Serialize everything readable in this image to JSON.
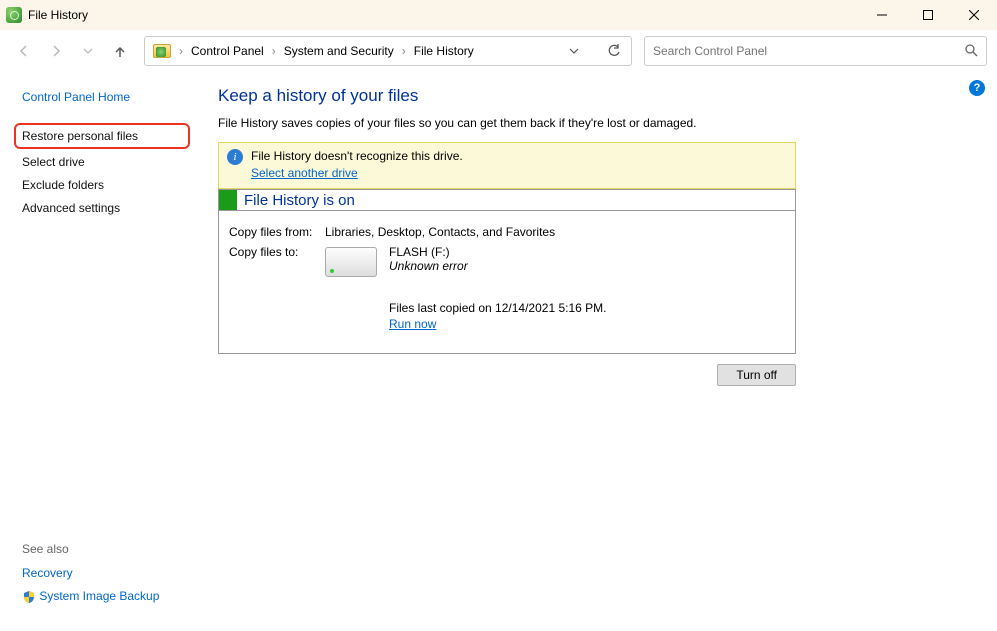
{
  "window": {
    "title": "File History"
  },
  "breadcrumbs": {
    "items": [
      "Control Panel",
      "System and Security",
      "File History"
    ]
  },
  "search": {
    "placeholder": "Search Control Panel"
  },
  "sidebar": {
    "home": "Control Panel Home",
    "restore": "Restore personal files",
    "select_drive": "Select drive",
    "exclude": "Exclude folders",
    "advanced": "Advanced settings",
    "see_also": "See also",
    "recovery": "Recovery",
    "sysimg": "System Image Backup"
  },
  "main": {
    "heading": "Keep a history of your files",
    "subtext": "File History saves copies of your files so you can get them back if they're lost or damaged.",
    "warning_text": "File History doesn't recognize this drive.",
    "warning_link": "Select another drive",
    "status_title": "File History is on",
    "copy_from_label": "Copy files from:",
    "copy_from_value": "Libraries, Desktop, Contacts, and Favorites",
    "copy_to_label": "Copy files to:",
    "drive_name": "FLASH (F:)",
    "drive_error": "Unknown error",
    "last_copied": "Files last copied on 12/14/2021 5:16 PM.",
    "run_now": "Run now",
    "turn_off": "Turn off"
  }
}
